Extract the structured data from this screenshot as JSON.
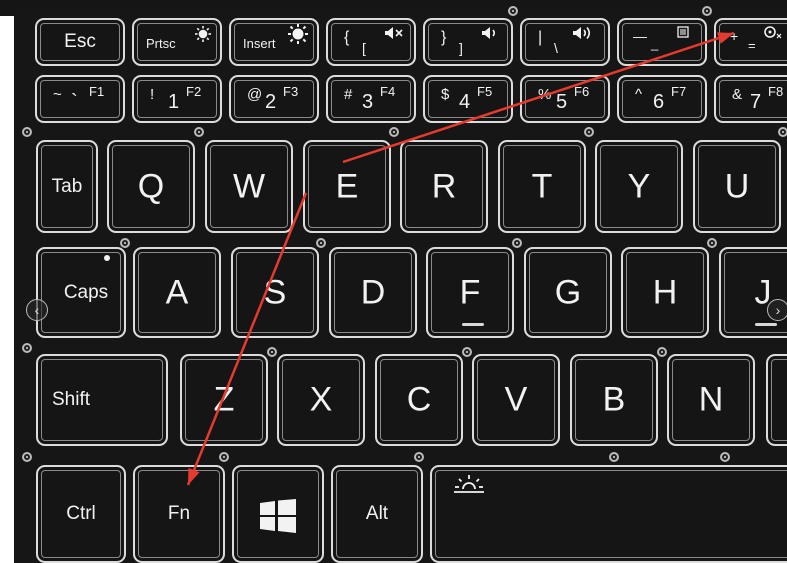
{
  "fn_row": {
    "esc": "Esc",
    "prtsc": "Prtsc",
    "prtsc_icon": "brightness-down-icon",
    "insert": "Insert",
    "insert_icon": "brightness-up-icon",
    "lbrace_top": "{",
    "lbrace_bottom": "[",
    "lbrace_icon": "mute-icon",
    "rbrace_top": "}",
    "rbrace_bottom": "]",
    "rbrace_icon": "volume-down-icon",
    "pipe_top": "|",
    "pipe_bottom": "\\",
    "pipe_icon": "volume-up-icon",
    "minus_top": "—",
    "minus_bottom": "_",
    "minus_icon": "list-icon",
    "plus_top": "+",
    "plus_bottom": "=",
    "plus_icon": "mic-off-icon"
  },
  "num_row": [
    {
      "top": "~",
      "bottom": "`",
      "f": "F1"
    },
    {
      "top": "!",
      "bottom": "1",
      "f": "F2"
    },
    {
      "top": "@",
      "bottom": "2",
      "f": "F3"
    },
    {
      "top": "#",
      "bottom": "3",
      "f": "F4"
    },
    {
      "top": "$",
      "bottom": "4",
      "f": "F5"
    },
    {
      "top": "%",
      "bottom": "5",
      "f": "F6"
    },
    {
      "top": "^",
      "bottom": "6",
      "f": "F7"
    },
    {
      "top": "&",
      "bottom": "7",
      "f": "F8"
    }
  ],
  "qwerty_row": [
    "Tab",
    "Q",
    "W",
    "E",
    "R",
    "T",
    "Y",
    "U"
  ],
  "home_row": [
    "Caps",
    "A",
    "S",
    "D",
    "F",
    "G",
    "H",
    "J"
  ],
  "shift_row": [
    "Shift",
    "Z",
    "X",
    "C",
    "V",
    "B",
    "N"
  ],
  "bottom_row": {
    "ctrl": "Ctrl",
    "fn": "Fn",
    "win_icon": "windows-logo-icon",
    "alt": "Alt",
    "space_icon": "keyboard-backlight-icon"
  },
  "annotation": {
    "color": "#e53a2e",
    "icon": "red-arrow-icon"
  }
}
